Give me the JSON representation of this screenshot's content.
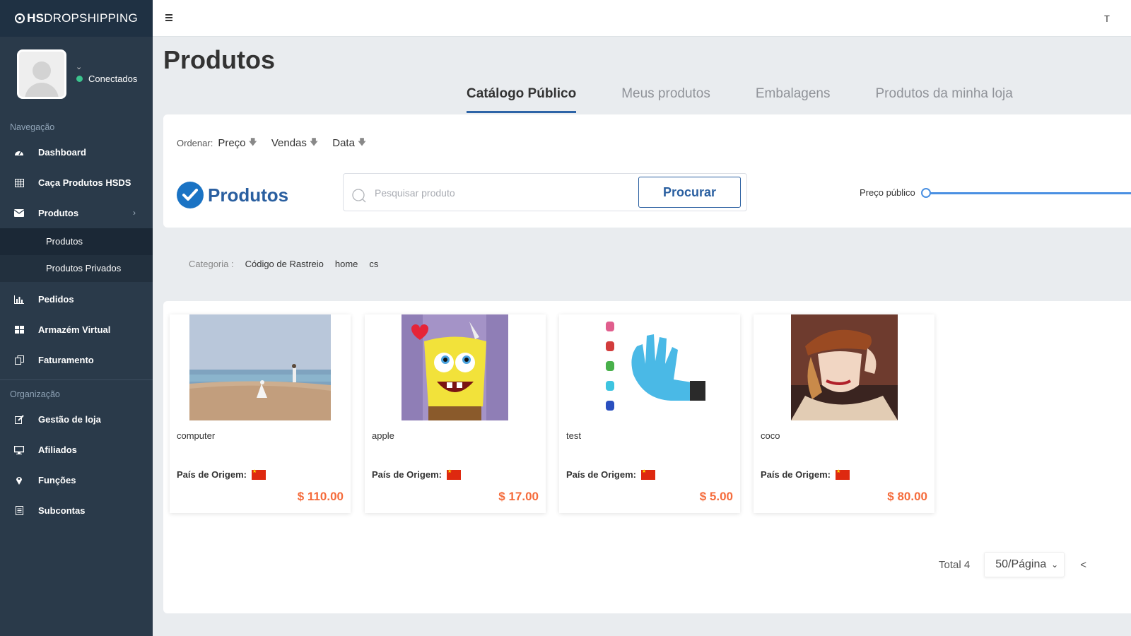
{
  "brand": {
    "prefix": "HS",
    "suffix": "DROPSHIPPING"
  },
  "user": {
    "status": "Conectados"
  },
  "nav": {
    "group1": "Navegação",
    "group2": "Organização",
    "items": [
      {
        "label": "Dashboard",
        "icon": "dashboard-icon"
      },
      {
        "label": "Caça Produtos HSDS",
        "icon": "table-icon"
      },
      {
        "label": "Produtos",
        "icon": "envelope-icon"
      },
      {
        "label": "Pedidos",
        "icon": "bar-chart-icon"
      },
      {
        "label": "Armazém Virtual",
        "icon": "grid-icon"
      },
      {
        "label": "Faturamento",
        "icon": "copy-icon"
      },
      {
        "label": "Gestão de loja",
        "icon": "edit-icon"
      },
      {
        "label": "Afiliados",
        "icon": "monitor-icon"
      },
      {
        "label": "Funções",
        "icon": "map-pin-icon"
      },
      {
        "label": "Subcontas",
        "icon": "document-icon"
      }
    ],
    "subitems": [
      "Produtos",
      "Produtos Privados"
    ]
  },
  "topbar": {
    "right_text": "T"
  },
  "page": {
    "title": "Produtos"
  },
  "tabs": [
    "Catálogo Público",
    "Meus produtos",
    "Embalagens",
    "Produtos da minha loja"
  ],
  "sort": {
    "label": "Ordenar:",
    "options": [
      "Preço",
      "Vendas",
      "Data"
    ]
  },
  "heading": "Produtos",
  "search": {
    "placeholder": "Pesquisar produto",
    "button": "Procurar"
  },
  "price_filter": {
    "label": "Preço público",
    "value": 0
  },
  "category": {
    "label": "Categoria :",
    "items": [
      "Código de Rastreio",
      "home",
      "cs"
    ]
  },
  "products": [
    {
      "name": "computer",
      "origin_label": "País de Origem:",
      "price": "$ 110.00"
    },
    {
      "name": "apple",
      "origin_label": "País de Origem:",
      "price": "$ 17.00"
    },
    {
      "name": "test",
      "origin_label": "País de Origem:",
      "price": "$ 5.00"
    },
    {
      "name": "coco",
      "origin_label": "País de Origem:",
      "price": "$ 80.00"
    }
  ],
  "pagination": {
    "total": "Total 4",
    "page_size": "50/Página",
    "prev": "<"
  },
  "colors": {
    "sidebar": "#2a3a4a",
    "accent": "#2a5fa0",
    "price": "#f56c3c",
    "online": "#3bc48e"
  }
}
